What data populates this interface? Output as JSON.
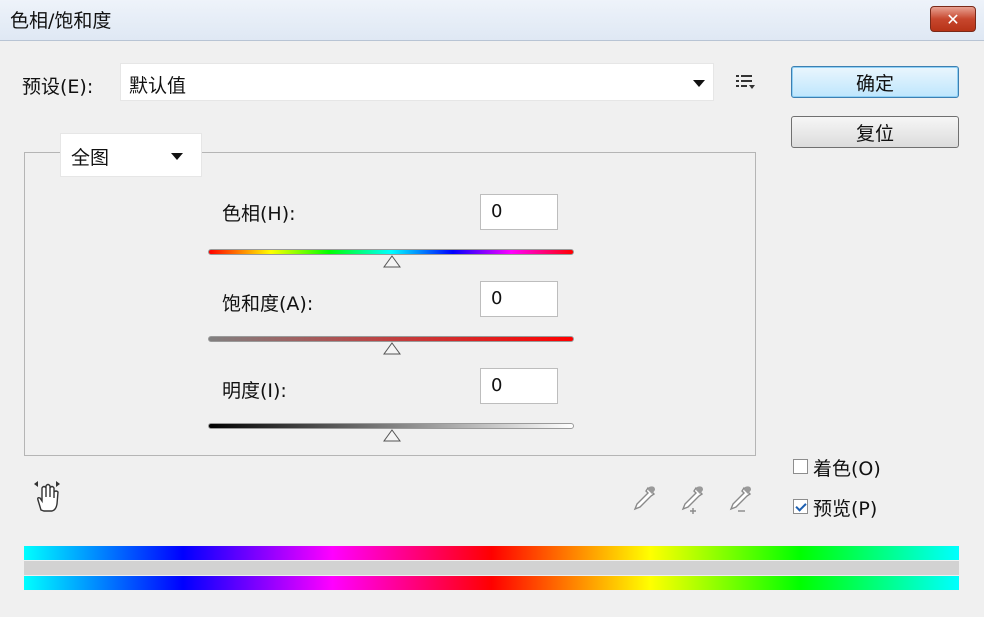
{
  "window": {
    "title": "色相/饱和度"
  },
  "preset": {
    "label": "预设(E):",
    "value": "默认值",
    "menu_icon": "preset-options-icon"
  },
  "buttons": {
    "ok": "确定",
    "reset": "复位"
  },
  "channel": {
    "value": "全图"
  },
  "sliders": {
    "hue": {
      "label": "色相(H):",
      "value": "0"
    },
    "saturation": {
      "label": "饱和度(A):",
      "value": "0"
    },
    "lightness": {
      "label": "明度(I):",
      "value": "0"
    }
  },
  "options": {
    "colorize": {
      "label": "着色(O)",
      "checked": false
    },
    "preview": {
      "label": "预览(P)",
      "checked": true
    }
  },
  "colors": {
    "close_button": "#c7472e",
    "hue_track": [
      "#ff0000",
      "#ffff00",
      "#00ff00",
      "#00ffff",
      "#0000ff",
      "#ff00ff",
      "#ff0000"
    ],
    "saturation_track": [
      "#808080",
      "#ff0000"
    ],
    "lightness_track": [
      "#000000",
      "#ffffff"
    ]
  },
  "icons": [
    "close-icon",
    "targeted-adjustment-hand-icon",
    "eyedropper-icon",
    "eyedropper-plus-icon",
    "eyedropper-minus-icon"
  ]
}
